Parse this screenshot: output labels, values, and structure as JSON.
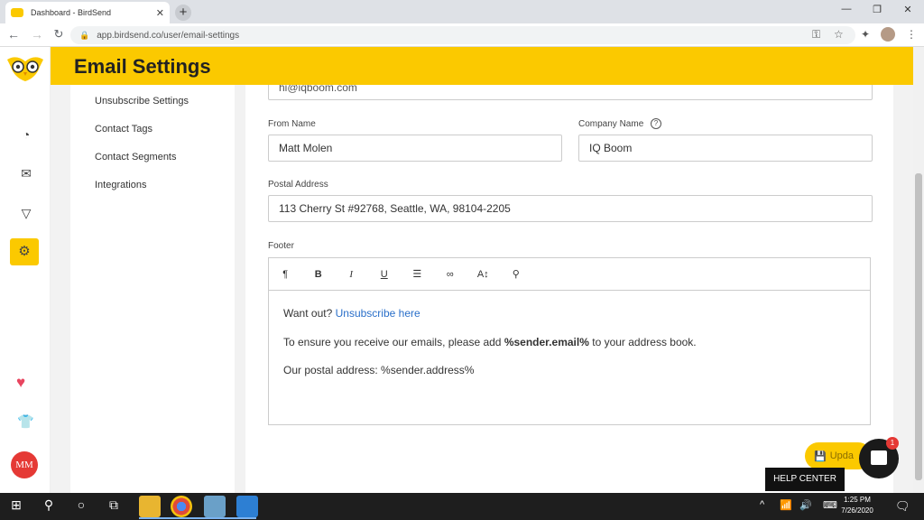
{
  "browser": {
    "tab_title": "Dashboard - BirdSend",
    "tab_close": "✕",
    "new_tab": "+",
    "url": "app.birdsend.co/user/email-settings"
  },
  "header": {
    "title": "Email Settings"
  },
  "subnav": {
    "items": [
      {
        "label": "Unsubscribe Settings"
      },
      {
        "label": "Contact Tags"
      },
      {
        "label": "Contact Segments"
      },
      {
        "label": "Integrations"
      }
    ]
  },
  "form": {
    "email_value": "hi@iqboom.com",
    "from_name_label": "From Name",
    "from_name_value": "Matt Molen",
    "company_name_label": "Company Name",
    "company_name_value": "IQ Boom",
    "postal_address_label": "Postal Address",
    "postal_address_value": "113 Cherry St #92768, Seattle, WA, 98104-2205",
    "footer_label": "Footer"
  },
  "toolbar": [
    "¶",
    "B",
    "I",
    "U"
  ],
  "editor": {
    "line1_prefix": "Want out?",
    "line1_link": "Unsubscribe here",
    "line2_prefix": "To ensure you receive our emails, please add",
    "line2_bold": "%sender.email%",
    "line2_suffix": "to your address book.",
    "line3": "Our postal address: %sender.address%"
  },
  "actions": {
    "update_label": "Upda",
    "chat_badge": "1",
    "help_center": "HELP CENTER"
  },
  "user": {
    "initials": "MM"
  },
  "taskbar": {
    "time": "1:25 PM",
    "date": "7/26/2020"
  },
  "colors": {
    "accent": "#fbc900",
    "link": "#2a6fc9",
    "heart": "#e8455f",
    "avatar": "#e53935"
  }
}
